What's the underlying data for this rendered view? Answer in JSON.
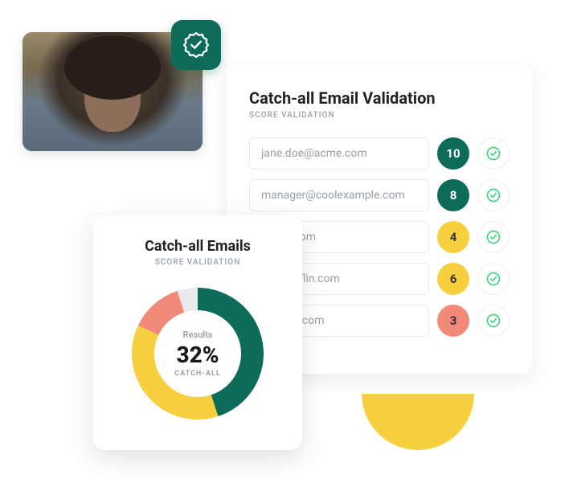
{
  "photo": {
    "alt": "Person portrait"
  },
  "badge": {
    "name": "verified-seal-icon"
  },
  "validation": {
    "title": "Catch-all Email Validation",
    "subtitle": "SCORE VALIDATION",
    "rows": [
      {
        "email": "jane.doe@acme.com",
        "score": "10",
        "color": "#0d6b5a",
        "text": "#fff"
      },
      {
        "email": "manager@coolexample.com",
        "score": "8",
        "color": "#0d6b5a",
        "text": "#fff"
      },
      {
        "email": "panyx.com",
        "score": "4",
        "color": "#f7d040",
        "text": "#333"
      },
      {
        "email": "ndermifflin.com",
        "score": "6",
        "color": "#f7d040",
        "text": "#333"
      },
      {
        "email": "@acme.com",
        "score": "3",
        "color": "#f28a7a",
        "text": "#333"
      }
    ]
  },
  "donut": {
    "title": "Catch-all Emails",
    "subtitle": "SCORE VALIDATION",
    "results_label": "Results",
    "percent": "32%",
    "catch_label": "CATCH-ALL"
  },
  "chart_data": {
    "type": "pie",
    "title": "Catch-all Emails",
    "center_value": 32,
    "center_label": "CATCH-ALL",
    "series": [
      {
        "name": "teal",
        "value": 45,
        "color": "#0d6b5a"
      },
      {
        "name": "yellow",
        "value": 37,
        "color": "#f7d040"
      },
      {
        "name": "coral",
        "value": 13,
        "color": "#f28a7a"
      },
      {
        "name": "light",
        "value": 5,
        "color": "#e8eaed"
      }
    ]
  }
}
